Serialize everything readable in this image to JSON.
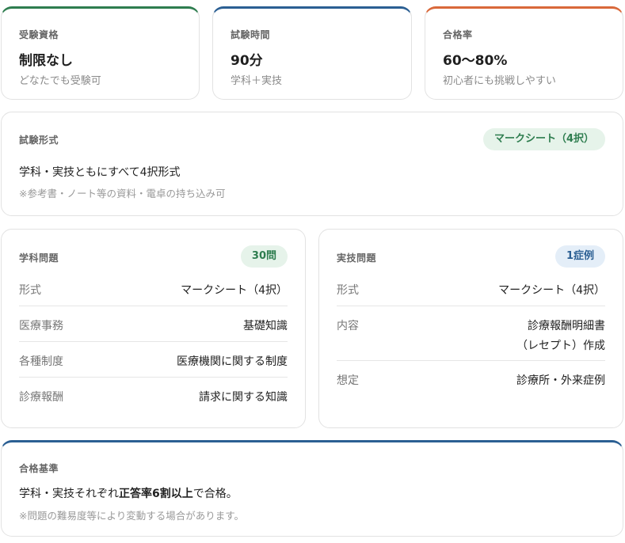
{
  "summary": [
    {
      "label": "受験資格",
      "value": "制限なし",
      "sub": "どなたでも受験可"
    },
    {
      "label": "試験時間",
      "value": "90分",
      "sub": "学科＋実技"
    },
    {
      "label": "合格率",
      "value": "60〜80%",
      "sub": "初心者にも挑戦しやすい"
    }
  ],
  "format": {
    "label": "試験形式",
    "badge": "マークシート（4択）",
    "text": "学科・実技ともにすべて4択形式",
    "note": "※参考書・ノート等の資料・電卓の持ち込み可"
  },
  "written": {
    "label": "学科問題",
    "badge": "30問",
    "rows": [
      {
        "key": "形式",
        "value": "マークシート（4択）"
      },
      {
        "key": "医療事務",
        "value": "基礎知識"
      },
      {
        "key": "各種制度",
        "value": "医療機関に関する制度"
      },
      {
        "key": "診療報酬",
        "value": "請求に関する知識"
      }
    ]
  },
  "practical": {
    "label": "実技問題",
    "badge": "1症例",
    "rows": [
      {
        "key": "形式",
        "value": "マークシート（4択）"
      },
      {
        "key": "内容",
        "value_line1": "診療報酬明細書",
        "value_line2": "（レセプト）作成"
      },
      {
        "key": "想定",
        "value": "診療所・外来症例"
      }
    ]
  },
  "pass": {
    "label": "合格基準",
    "text_pre": "学科・実技それぞれ",
    "text_bold": "正答率6割以上",
    "text_post": "で合格。",
    "note": "※問題の難易度等により変動する場合があります。"
  },
  "colors": {
    "green": "#2e7d4f",
    "blue": "#2b5f93",
    "orange": "#d9683a"
  }
}
